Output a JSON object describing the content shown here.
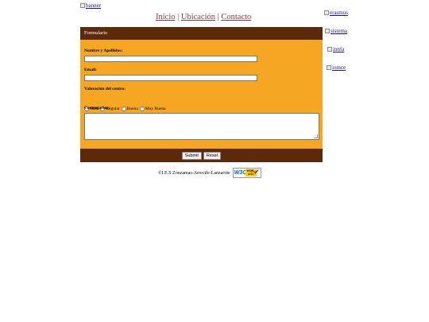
{
  "images": {
    "banner_alt": "banner",
    "erasmus_alt": "erasmus",
    "sistema_alt": "sistema",
    "innfa_alt": "innfa",
    "iomce_alt": "iomce"
  },
  "nav": {
    "inicio": "Inicio",
    "ubicacion": "Ubicación",
    "contacto": "Contacto",
    "separator": "|"
  },
  "form": {
    "title": "Formulario",
    "name_label": "Nombre y Apellidos:",
    "name_value": "",
    "email_label": "Email:",
    "email_value": "",
    "rating_label": "Valoración del centro:",
    "rating_options": [
      "Mala",
      "Regular",
      "Buena",
      "Muy Buena"
    ],
    "comments_label": "Comentarios:",
    "comments_value": "",
    "submit_label": "Submit",
    "reset_label": "Reset"
  },
  "footer": {
    "copyright": "©I.E.S Zonzamas-Arrecife-Lanzarote",
    "badge_w3c": "W3C",
    "badge_text_1": "HTML",
    "badge_text_2": "4.01"
  },
  "colors": {
    "form_bg": "#f5a623",
    "bar_bg": "#5a2a0a",
    "nav_link": "#8b3a3a"
  }
}
